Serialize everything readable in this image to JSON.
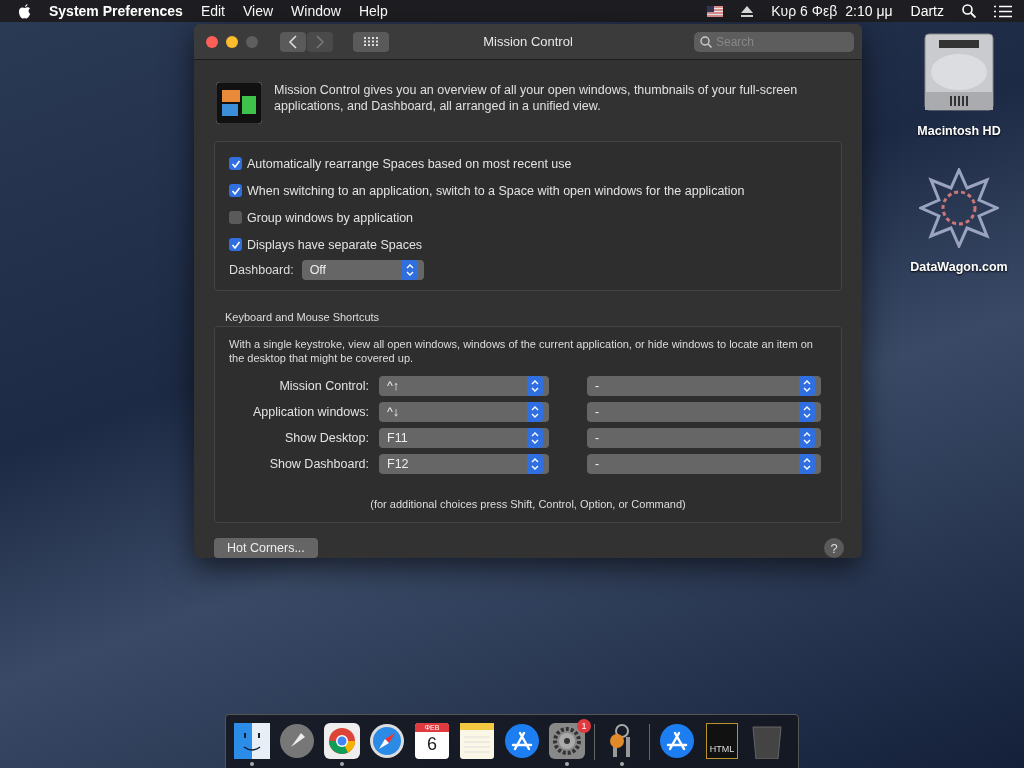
{
  "menubar": {
    "app_name": "System Preferences",
    "menus": [
      "Edit",
      "View",
      "Window",
      "Help"
    ],
    "date": "Κυρ 6 Φεβ",
    "time": "2:10 μμ",
    "user": "Dartz"
  },
  "desktop_icons": [
    {
      "kind": "drive",
      "label": "Macintosh HD"
    },
    {
      "kind": "star",
      "label": "DataWagon.com"
    }
  ],
  "window": {
    "title": "Mission Control",
    "nav": [
      {
        "kind": "back",
        "disabled": false
      },
      {
        "kind": "forward",
        "disabled": true
      }
    ],
    "search": {
      "placeholder": "Search"
    },
    "description": "Mission Control gives you an overview of all your open windows, thumbnails of your full-screen applications, and Dashboard, all arranged in a unified view.",
    "options": [
      {
        "label": "Automatically rearrange Spaces based on most recent use",
        "checked": true
      },
      {
        "label": "When switching to an application, switch to a Space with open windows for the application",
        "checked": true
      },
      {
        "label": "Group windows by application",
        "checked": false
      },
      {
        "label": "Displays have separate Spaces",
        "checked": true
      }
    ],
    "dashboard": {
      "label": "Dashboard:",
      "value": "Off"
    },
    "shortcuts": {
      "heading": "Keyboard and Mouse Shortcuts",
      "description": "With a single keystroke, view all open windows, windows of the current application, or hide windows to locate an item on the desktop that might be covered up.",
      "rows": [
        {
          "label": "Mission Control:",
          "key": "^↑",
          "mouse": "-"
        },
        {
          "label": "Application windows:",
          "key": "^↓",
          "mouse": "-"
        },
        {
          "label": "Show Desktop:",
          "key": "F11",
          "mouse": "-"
        },
        {
          "label": "Show Dashboard:",
          "key": "F12",
          "mouse": "-"
        }
      ],
      "note": "(for additional choices press Shift, Control, Option, or Command)"
    },
    "hot_corners_button": "Hot Corners...",
    "help_button": "?"
  },
  "dock": [
    {
      "kind": "finder",
      "running": true
    },
    {
      "kind": "launchpad",
      "running": false
    },
    {
      "kind": "chrome",
      "running": true
    },
    {
      "kind": "safari",
      "running": false
    },
    {
      "kind": "calendar",
      "running": false,
      "month": "ΦΕΒ",
      "day": "6"
    },
    {
      "kind": "notes",
      "running": false
    },
    {
      "kind": "appstore",
      "running": false
    },
    {
      "kind": "sysprefs",
      "running": true,
      "badge": "1"
    },
    {
      "kind": "separator"
    },
    {
      "kind": "keychain",
      "running": true
    },
    {
      "kind": "separator"
    },
    {
      "kind": "appstore",
      "running": false
    },
    {
      "kind": "htmlfile",
      "running": false,
      "text": "HTML"
    },
    {
      "kind": "trash",
      "running": false
    }
  ]
}
